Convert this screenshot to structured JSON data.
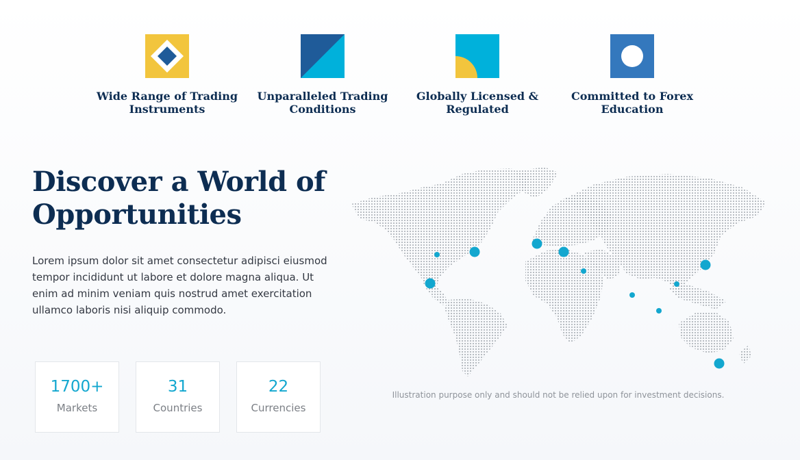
{
  "features": [
    {
      "title": "Wide Range of Trading\nInstruments",
      "icon": "diamond-square-icon"
    },
    {
      "title": "Unparalleled Trading\nConditions",
      "icon": "diagonal-split-icon"
    },
    {
      "title": "Globally Licensed &\nRegulated",
      "icon": "quarter-circle-icon"
    },
    {
      "title": "Committed to Forex\nEducation",
      "icon": "circle-icon"
    }
  ],
  "hero": {
    "title": "Discover a World of\nOpportunities",
    "text": "Lorem ipsum dolor sit amet consectetur adipisci eiusmod tempor incididunt ut labore et dolore magna aliqua. Ut enim ad minim veniam quis nostrud amet exercitation ullamco laboris nisi aliquip commodo."
  },
  "stats": [
    {
      "value": "1700+",
      "label": "Markets"
    },
    {
      "value": "31",
      "label": "Countries"
    },
    {
      "value": "22",
      "label": "Currencies"
    }
  ],
  "map": {
    "disclaimer": "Illustration purpose only and should not be relied upon for investment decisions."
  },
  "colors": {
    "navy": "#0d2d52",
    "accent": "#13a7cf",
    "yellow": "#f2c53d",
    "blue_dark": "#1f5b99",
    "cyan": "#00b1db",
    "blue_mid": "#3478bd"
  }
}
